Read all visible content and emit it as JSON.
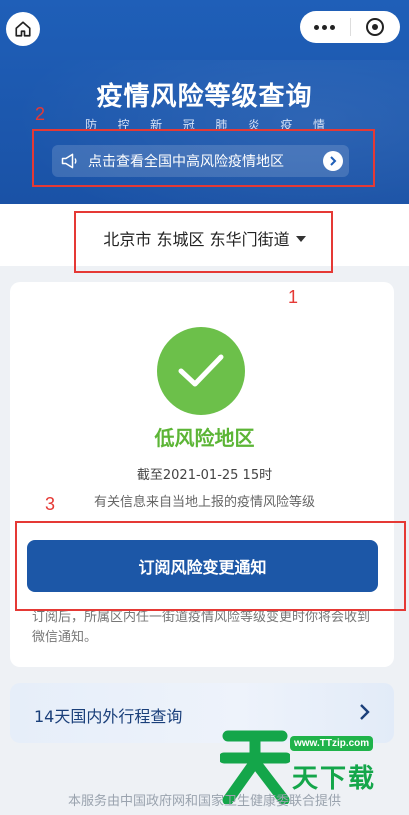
{
  "header": {
    "title": "疫情风险等级查询",
    "subtitle_chars": [
      "防",
      "控",
      "新",
      "冠",
      "肺",
      "炎",
      "疫",
      "情"
    ],
    "notice": "点击查看全国中高风险疫情地区"
  },
  "annotations": {
    "box1_label": "1",
    "box2_label": "2",
    "box3_label": "3"
  },
  "location": {
    "text": "北京市 东城区 东华门街道"
  },
  "result": {
    "risk_level": "低风险地区",
    "as_of": "截至2021-01-25 15时",
    "source": "有关信息来自当地上报的疫情风险等级",
    "accent_color": "#6cc04a"
  },
  "subscribe": {
    "button_label": "订阅风险变更通知",
    "note": "订阅后，所属区内任一街道疫情风险等级变更时你将会收到微信通知。"
  },
  "trip": {
    "label": "14天国内外行程查询"
  },
  "watermark": {
    "url": "www.TTzip.com",
    "text": "天下载"
  },
  "footer": {
    "text": "本服务由中国政府网和国家卫生健康委联合提供"
  },
  "colors": {
    "header_blue": "#1f5fb8",
    "button_blue": "#1c57a7",
    "annotation_red": "#e53935"
  }
}
